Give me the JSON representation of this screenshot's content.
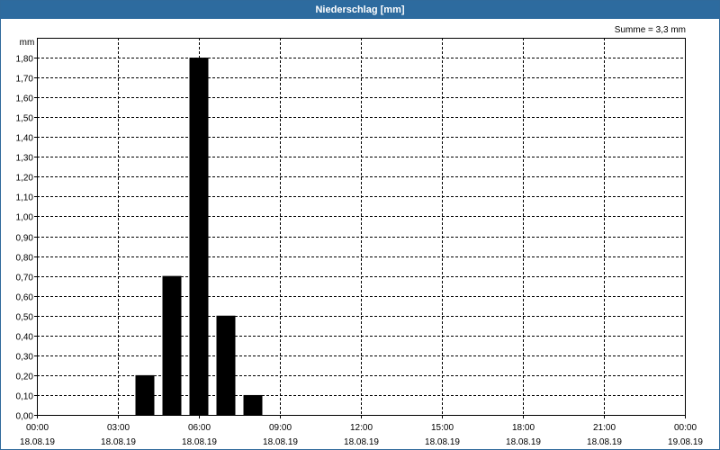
{
  "window": {
    "title": "Niederschlag [mm]"
  },
  "summary": "Summe = 3,3 mm",
  "chart_data": {
    "type": "bar",
    "title": "Niederschlag [mm]",
    "ylabel": "mm",
    "xlabel": "",
    "ylim": [
      0,
      1.9
    ],
    "xlim": [
      "18.08.19 00:00",
      "19.08.19 00:00"
    ],
    "grid": true,
    "yticks": [
      "0,00",
      "0,10",
      "0,20",
      "0,30",
      "0,40",
      "0,50",
      "0,60",
      "0,70",
      "0,80",
      "0,90",
      "1,00",
      "1,10",
      "1,20",
      "1,30",
      "1,40",
      "1,50",
      "1,60",
      "1,70",
      "1,80"
    ],
    "xticks": [
      {
        "time": "00:00",
        "date": "18.08.19"
      },
      {
        "time": "03:00",
        "date": "18.08.19"
      },
      {
        "time": "06:00",
        "date": "18.08.19"
      },
      {
        "time": "09:00",
        "date": "18.08.19"
      },
      {
        "time": "12:00",
        "date": "18.08.19"
      },
      {
        "time": "15:00",
        "date": "18.08.19"
      },
      {
        "time": "18:00",
        "date": "18.08.19"
      },
      {
        "time": "21:00",
        "date": "18.08.19"
      },
      {
        "time": "00:00",
        "date": "19.08.19"
      }
    ],
    "bars": [
      {
        "time": "04:00",
        "value": 0.2
      },
      {
        "time": "05:00",
        "value": 0.7
      },
      {
        "time": "06:00",
        "value": 1.8
      },
      {
        "time": "07:00",
        "value": 0.5
      },
      {
        "time": "08:00",
        "value": 0.1
      }
    ],
    "colors": {
      "bar": "#000000",
      "grid": "#000000",
      "title_bar": "#2d6b9f"
    }
  }
}
